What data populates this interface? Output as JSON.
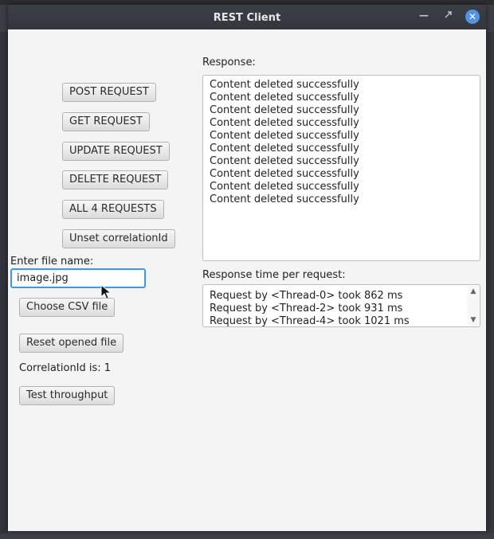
{
  "window": {
    "title": "REST Client"
  },
  "buttons": {
    "post": "POST REQUEST",
    "get": "GET REQUEST",
    "update": "UPDATE REQUEST",
    "delete": "DELETE REQUEST",
    "all4": "ALL 4 REQUESTS",
    "unset": "Unset correlationId",
    "choose_csv": "Choose CSV file",
    "reset_file": "Reset opened file",
    "throughput": "Test throughput"
  },
  "file_input": {
    "label": "Enter file name:",
    "value": "image.jpg"
  },
  "correlation": {
    "text": "CorrelationId is: 1"
  },
  "response": {
    "label": "Response:",
    "lines": [
      "Content deleted successfully",
      "Content deleted successfully",
      "Content deleted successfully",
      "Content deleted successfully",
      "Content deleted successfully",
      "Content deleted successfully",
      "Content deleted successfully",
      "Content deleted successfully",
      "Content deleted successfully",
      "Content deleted successfully"
    ]
  },
  "timing": {
    "label": "Response time per request:",
    "lines": [
      "Request by <Thread-0> took 862 ms",
      "Request by <Thread-2> took 931 ms",
      "Request by <Thread-4> took 1021 ms"
    ]
  },
  "colors": {
    "accent": "#3c9be7",
    "close_button": "#5294e2",
    "background": "#f4f4f4"
  },
  "icons": {
    "close": "close-icon",
    "minimize": "minimize-icon",
    "maximize": "maximize-icon"
  }
}
